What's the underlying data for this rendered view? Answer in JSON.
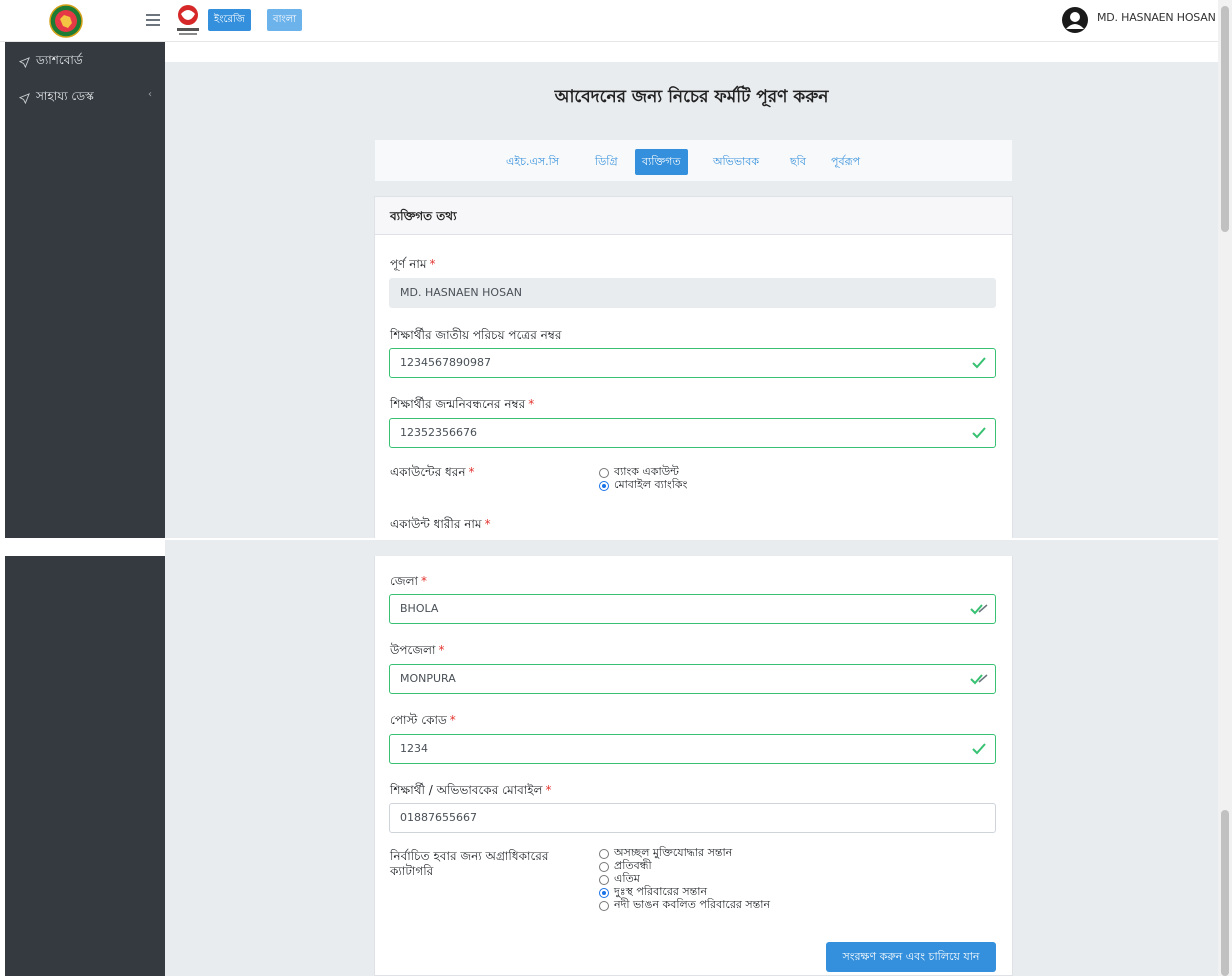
{
  "header": {
    "lang_en": "ইংরেজি",
    "lang_bn": "বাংলা",
    "username": "MD. HASNAEN HOSAN"
  },
  "sidebar": {
    "items": [
      {
        "label": "ড্যাশবোর্ড",
        "icon": "send-icon"
      },
      {
        "label": "সাহায্য ডেস্ক",
        "icon": "send-icon",
        "has_chevron": true
      }
    ],
    "chevron": "‹"
  },
  "page": {
    "title": "আবেদনের জন্য নিচের ফর্মটি পূরণ করুন"
  },
  "tabs": [
    {
      "label": "এইচ.এস.সি",
      "active": false
    },
    {
      "label": "ডিগ্রি",
      "active": false
    },
    {
      "label": "ব্যক্তিগত",
      "active": true
    },
    {
      "label": "অভিভাবক",
      "active": false
    },
    {
      "label": "ছবি",
      "active": false
    },
    {
      "label": "পূর্বরূপ",
      "active": false
    }
  ],
  "card": {
    "header": "ব্যক্তিগত তথ্য"
  },
  "form": {
    "full_name_label": "পূর্ণ নাম",
    "full_name_value": "MD. HASNAEN HOSAN",
    "nid_label": "শিক্ষার্থীর জাতীয় পরিচয় পত্রের নম্বর",
    "nid_value": "1234567890987",
    "birth_reg_label": "শিক্ষার্থীর জন্মনিবন্ধনের নম্বর",
    "birth_reg_value": "12352356676",
    "account_type_label": "একাউন্টের ধরন",
    "account_type_options": [
      {
        "label": "ব্যাংক একাউন্ট",
        "selected": false
      },
      {
        "label": "মোবাইল ব্যাংকিং",
        "selected": true
      }
    ],
    "account_holder_label": "একাউন্ট ধারীর নাম",
    "district_label": "জেলা",
    "district_value": "BHOLA",
    "upazila_label": "উপজেলা",
    "upazila_value": "MONPURA",
    "postcode_label": "পোস্ট কোড",
    "postcode_value": "1234",
    "mobile_label": "শিক্ষার্থী / অভিভাবকের মোবাইল",
    "mobile_value": "01887655667",
    "priority_label": "নির্বাচিত হবার জন্য অগ্রাধিকারের ক্যাটাগরি",
    "priority_options": [
      {
        "label": "অসচ্ছল মুক্তিযোদ্ধার সন্তান",
        "selected": false
      },
      {
        "label": "প্রতিবন্ধী",
        "selected": false
      },
      {
        "label": "এতিম",
        "selected": false
      },
      {
        "label": "দুঃস্থ পরিবারের সন্তান",
        "selected": true
      },
      {
        "label": "নদী ভাঙন কবলিত পরিবারের সন্তান",
        "selected": false
      }
    ],
    "required_mark": "*",
    "save_button": "সংরক্ষণ করুন এবং চালিয়ে যান"
  },
  "colors": {
    "primary": "#3490dc",
    "sidebar_bg": "#343a40",
    "valid_border": "#38c172",
    "required": "#e3342f"
  }
}
